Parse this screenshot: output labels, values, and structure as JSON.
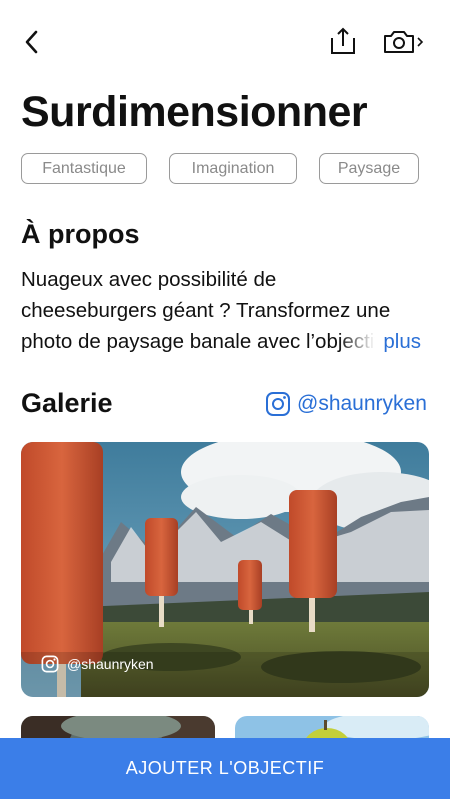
{
  "header": {
    "back_icon": "chevron-left-icon",
    "share_icon": "share-icon",
    "camera_icon": "camera-icon"
  },
  "page": {
    "title": "Surdimensionner"
  },
  "tags": [
    "Fantastique",
    "Imagination",
    "Paysage"
  ],
  "about": {
    "heading": "À propos",
    "line1": "Nuageux avec possibilité de",
    "line2": "cheeseburgers géant ? Transformez une",
    "line3": "photo de paysage banale avec l’objectif",
    "more_label": "plus"
  },
  "gallery": {
    "heading": "Galerie",
    "instagram_handle": "@shaunryken",
    "hero_caption": "@shaunryken"
  },
  "cta": {
    "label": "AJOUTER L'OBJECTIF"
  },
  "colors": {
    "accent": "#2a6fd6",
    "cta_bg": "#3b7ee8"
  }
}
